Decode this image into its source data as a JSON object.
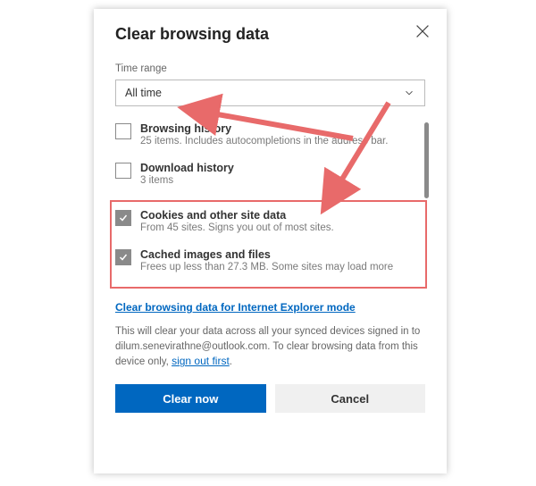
{
  "dialog": {
    "title": "Clear browsing data",
    "timerange_label": "Time range",
    "timerange_value": "All time",
    "items": [
      {
        "title": "Browsing history",
        "sub": "25 items. Includes autocompletions in the address bar.",
        "checked": false
      },
      {
        "title": "Download history",
        "sub": "3 items",
        "checked": false
      },
      {
        "title": "Cookies and other site data",
        "sub": "From 45 sites. Signs you out of most sites.",
        "checked": true
      },
      {
        "title": "Cached images and files",
        "sub": "Frees up less than 27.3 MB. Some sites may load more",
        "checked": true
      }
    ],
    "ie_link": "Clear browsing data for Internet Explorer mode",
    "sync_note_1": "This will clear your data across all your synced devices signed in to ",
    "sync_email": "dilum.senevirathne@outlook.com",
    "sync_note_2": ". To clear browsing data from this device only, ",
    "signout_link": "sign out first",
    "sync_note_3": ".",
    "primary_btn": "Clear now",
    "secondary_btn": "Cancel"
  }
}
